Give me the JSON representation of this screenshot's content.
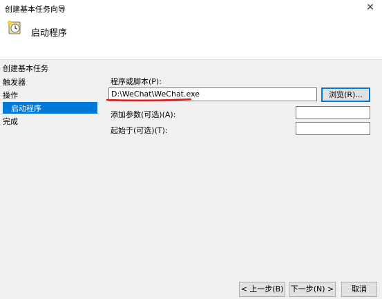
{
  "window": {
    "title": "创建基本任务向导",
    "close_glyph": "✕"
  },
  "header": {
    "heading": "启动程序",
    "icon": "task-clock-icon"
  },
  "steps": [
    {
      "label": "创建基本任务"
    },
    {
      "label": "触发器"
    },
    {
      "label": "操作"
    },
    {
      "label": "启动程序"
    },
    {
      "label": "完成"
    }
  ],
  "form": {
    "program_label": "程序或脚本(P):",
    "program_value": "D:\\WeChat\\WeChat.exe",
    "browse_label": "浏览(R)...",
    "args_label": "添加参数(可选)(A):",
    "args_value": "",
    "startin_label": "起始于(可选)(T):",
    "startin_value": ""
  },
  "footer": {
    "back_label": "< 上一步(B)",
    "next_label": "下一步(N) >",
    "cancel_label": "取消"
  },
  "colors": {
    "accent": "#0078d7",
    "annotation": "#e02020"
  }
}
